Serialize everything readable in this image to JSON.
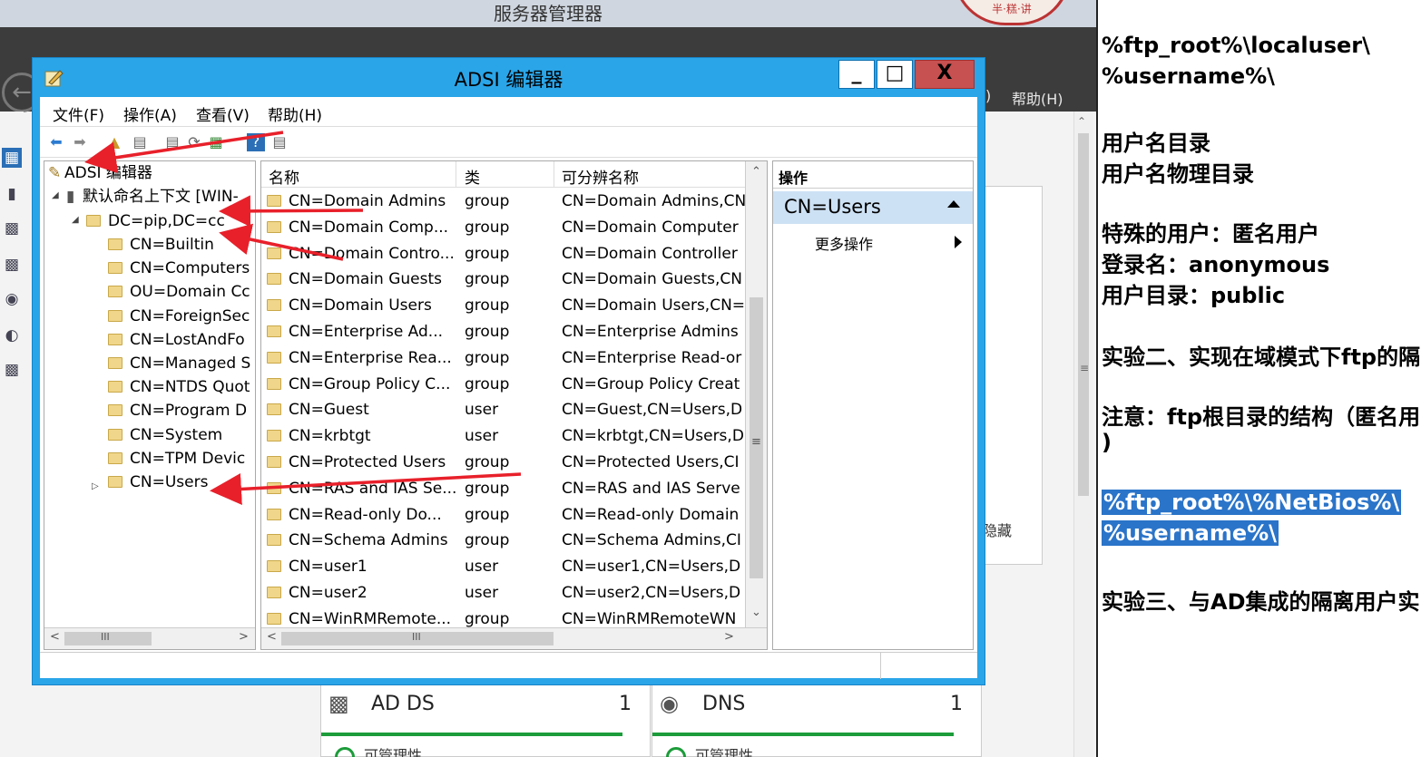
{
  "server_manager": {
    "title": "服务器管理器",
    "help_menu": "帮助(H)",
    "paren": ")",
    "hidden_label": "隐藏",
    "seal_text": "半·糕·讲",
    "tiles": [
      {
        "name": "AD DS",
        "count": "1",
        "status": "可管理性",
        "icon": "ad-ds-icon"
      },
      {
        "name": "DNS",
        "count": "1",
        "status": "可管理性",
        "icon": "dns-icon"
      }
    ]
  },
  "adsi": {
    "title": "ADSI 编辑器",
    "controls": {
      "minimize": "_",
      "maximize": "□",
      "close": "X"
    },
    "menu": [
      "文件(F)",
      "操作(A)",
      "查看(V)",
      "帮助(H)"
    ],
    "tree": {
      "root": "ADSI 编辑器",
      "context": "默认命名上下文 [WIN-",
      "domain": "DC=pip,DC=cc",
      "children": [
        "CN=Builtin",
        "CN=Computers",
        "OU=Domain Cc",
        "CN=ForeignSec",
        "CN=LostAndFo",
        "CN=Managed S",
        "CN=NTDS Quot",
        "CN=Program D",
        "CN=System",
        "CN=TPM Devic",
        "CN=Users"
      ]
    },
    "list": {
      "columns": [
        "名称",
        "类",
        "可分辨名称"
      ],
      "rows": [
        [
          "CN=Domain Admins",
          "group",
          "CN=Domain Admins,CN"
        ],
        [
          "CN=Domain Comp...",
          "group",
          "CN=Domain Computer"
        ],
        [
          "CN=Domain Contro...",
          "group",
          "CN=Domain Controller"
        ],
        [
          "CN=Domain Guests",
          "group",
          "CN=Domain Guests,CN"
        ],
        [
          "CN=Domain Users",
          "group",
          "CN=Domain Users,CN="
        ],
        [
          "CN=Enterprise Ad...",
          "group",
          "CN=Enterprise Admins"
        ],
        [
          "CN=Enterprise Rea...",
          "group",
          "CN=Enterprise Read-or"
        ],
        [
          "CN=Group Policy C...",
          "group",
          "CN=Group Policy Creat"
        ],
        [
          "CN=Guest",
          "user",
          "CN=Guest,CN=Users,D"
        ],
        [
          "CN=krbtgt",
          "user",
          "CN=krbtgt,CN=Users,D"
        ],
        [
          "CN=Protected Users",
          "group",
          "CN=Protected Users,CI"
        ],
        [
          "CN=RAS and IAS Se...",
          "group",
          "CN=RAS and IAS Serve"
        ],
        [
          "CN=Read-only Do...",
          "group",
          "CN=Read-only Domain"
        ],
        [
          "CN=Schema Admins",
          "group",
          "CN=Schema Admins,CI"
        ],
        [
          "CN=user1",
          "user",
          "CN=user1,CN=Users,D"
        ],
        [
          "CN=user2",
          "user",
          "CN=user2,CN=Users,D"
        ],
        [
          "CN=WinRMRemote...",
          "group",
          "CN=WinRMRemoteWN"
        ]
      ]
    },
    "actions": {
      "header": "操作",
      "selected": "CN=Users",
      "more": "更多操作"
    }
  },
  "notes": [
    {
      "text": "%ftp_root%\\localuser\\",
      "highlight": false
    },
    {
      "text": "%username%\\",
      "highlight": false
    },
    {
      "text": "用户名目录",
      "highlight": false
    },
    {
      "text": "用户名物理目录",
      "highlight": false
    },
    {
      "text": "特殊的用户：匿名用户",
      "highlight": false
    },
    {
      "text": "登录名：anonymous",
      "highlight": false
    },
    {
      "text": "用户目录：public",
      "highlight": false
    },
    {
      "text": "实验二、实现在域模式下ftp的隔",
      "highlight": false
    },
    {
      "text": "注意：ftp根目录的结构（匿名用",
      "highlight": false
    },
    {
      "text": ")",
      "highlight": false
    },
    {
      "text": "%ftp_root%\\%NetBios%\\",
      "highlight": true
    },
    {
      "text": "%username%\\",
      "highlight": true
    },
    {
      "text": "实验三、与AD集成的隔离用户实",
      "highlight": false
    }
  ],
  "colors": {
    "accent": "#2aa5e8",
    "close": "#c75050",
    "selection": "#cde1f4",
    "arrow": "#e8202a",
    "highlight": "#2a74c9"
  }
}
